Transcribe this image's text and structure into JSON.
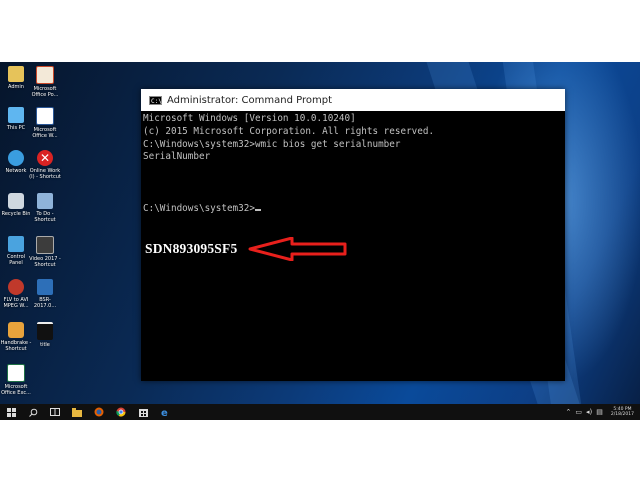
{
  "desktop_icons": [
    {
      "label": "Admin",
      "icon": "user-folder-icon"
    },
    {
      "label": "Microsoft\nOffice Po...",
      "icon": "powerpoint-icon"
    },
    {
      "label": "This PC",
      "icon": "computer-icon"
    },
    {
      "label": "Microsoft\nOffice W...",
      "icon": "word-icon"
    },
    {
      "label": "Network",
      "icon": "network-icon"
    },
    {
      "label": "Online Work\n(I) - Shortcut",
      "icon": "red-x-icon"
    },
    {
      "label": "Recycle Bin",
      "icon": "recycle-bin-icon"
    },
    {
      "label": "To Do -\nShortcut",
      "icon": "todo-icon"
    },
    {
      "label": "Control Panel",
      "icon": "control-panel-icon"
    },
    {
      "label": "Video 2017 -\nShortcut",
      "icon": "video-icon"
    },
    {
      "label": "FLV to AVI\nMPEG W...",
      "icon": "converter-icon"
    },
    {
      "label": "BSR-2017.0...",
      "icon": "bsr-icon"
    },
    {
      "label": "Handbrake -\nShortcut",
      "icon": "handbrake-icon"
    },
    {
      "label": "title",
      "icon": "title-file-icon"
    },
    {
      "label": "Microsoft\nOffice Exc...",
      "icon": "excel-icon"
    }
  ],
  "window": {
    "title": "Administrator: Command Prompt",
    "title_icon_text": "C:\\."
  },
  "console": {
    "lines": [
      "Microsoft Windows [Version 10.0.10240]",
      "(c) 2015 Microsoft Corporation. All rights reserved.",
      "",
      "C:\\Windows\\system32>wmic bios get serialnumber",
      "SerialNumber",
      "",
      "",
      "C:\\Windows\\system32>"
    ],
    "serial_value": "SDN893095SF5"
  },
  "colors": {
    "arrow": "#e8201c",
    "console_text": "#c0c0c0",
    "console_bg": "#000000"
  },
  "taskbar": {
    "items": [
      "start-icon",
      "search-icon",
      "task-view-icon",
      "folder-icon",
      "firefox-icon",
      "chrome-icon",
      "store-icon",
      "edge-icon",
      "file-explorer-icon",
      "edge-browser-icon"
    ],
    "clock_time": "5:40 PM",
    "clock_date": "2/18/2017"
  }
}
